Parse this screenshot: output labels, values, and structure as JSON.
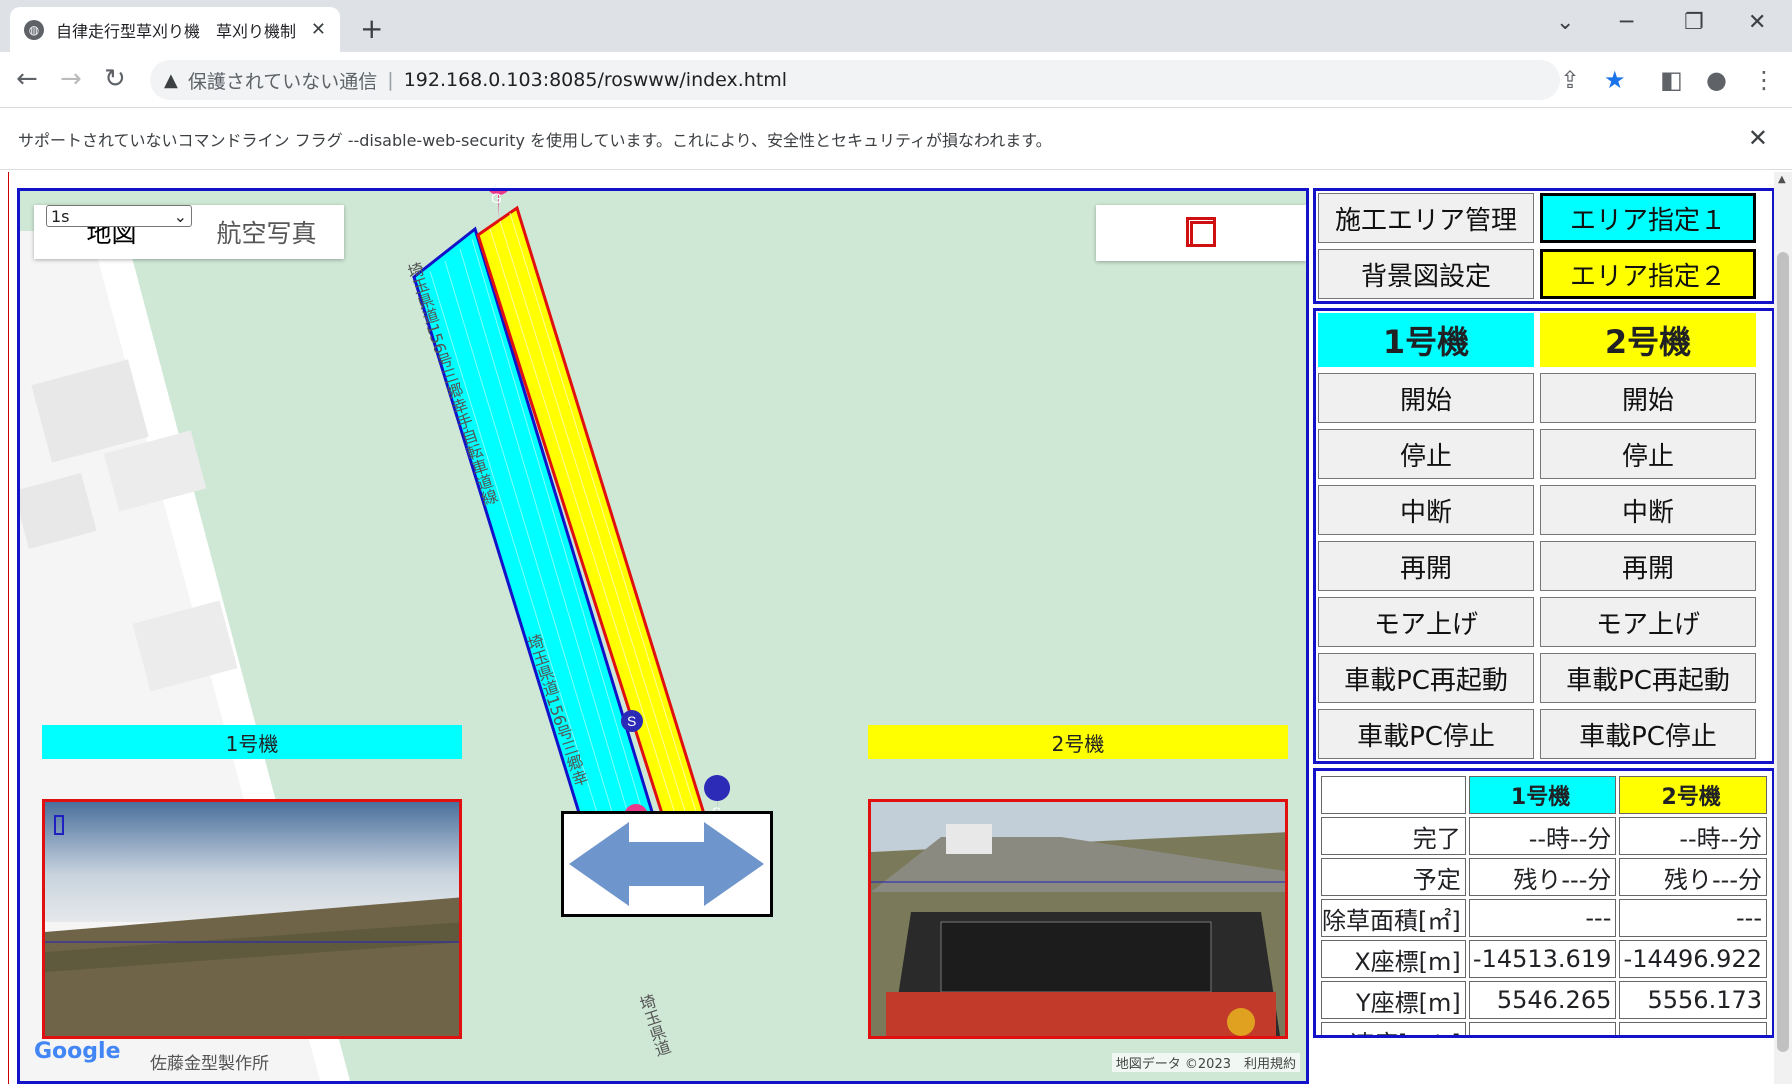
{
  "browser": {
    "tab_title": "自律走行型草刈り機　草刈り機制",
    "address_insecure": "保護されていない通信",
    "address_url": "192.168.0.103:8085/roswww/index.html",
    "infobar_text": "サポートされていないコマンドライン フラグ --disable-web-security を使用しています。これにより、安全性とセキュリティが損なわれます。"
  },
  "map": {
    "rate_select": "1s",
    "type_map": "地図",
    "type_satellite": "航空写真",
    "road_label_1": "埼玉県道156号三郷幸手自転車道線",
    "road_label_2": "埼玉県道156号三郷幸",
    "road_label_3": "埼玉県道",
    "robot1_label": "1号機",
    "robot2_label": "2号機",
    "marker_g": "G",
    "marker_s": "S",
    "google_logo": "Google",
    "poi_label": "佐藤金型製作所",
    "attribution": "地図データ ©2023　利用規約"
  },
  "panel": {
    "area_manage": "施工エリア管理",
    "area_select1": "エリア指定１",
    "bg_setting": "背景図設定",
    "area_select2": "エリア指定２",
    "robot1_header": "1号機",
    "robot2_header": "2号機",
    "controls": [
      "開始",
      "停止",
      "中断",
      "再開",
      "モア上げ",
      "車載PC再起動",
      "車載PC停止"
    ],
    "status": {
      "col1": "1号機",
      "col2": "2号機",
      "rows": [
        {
          "label": "完了",
          "v1": "--時--分",
          "v2": "--時--分"
        },
        {
          "label": "予定",
          "v1": "残り---分",
          "v2": "残り---分"
        },
        {
          "label": "除草面積[㎡]",
          "v1": "---",
          "v2": "---"
        },
        {
          "label": "X座標[m]",
          "v1": "-14513.619",
          "v2": "-14496.922"
        },
        {
          "label": "Y座標[m]",
          "v1": "5546.265",
          "v2": "5556.173"
        },
        {
          "label": "速度[m/s]",
          "v1": "--.--",
          "v2": "--.--"
        }
      ]
    }
  },
  "colors": {
    "robot1": "#00ffff",
    "robot2": "#ffff00",
    "frame": "#1212c8"
  }
}
